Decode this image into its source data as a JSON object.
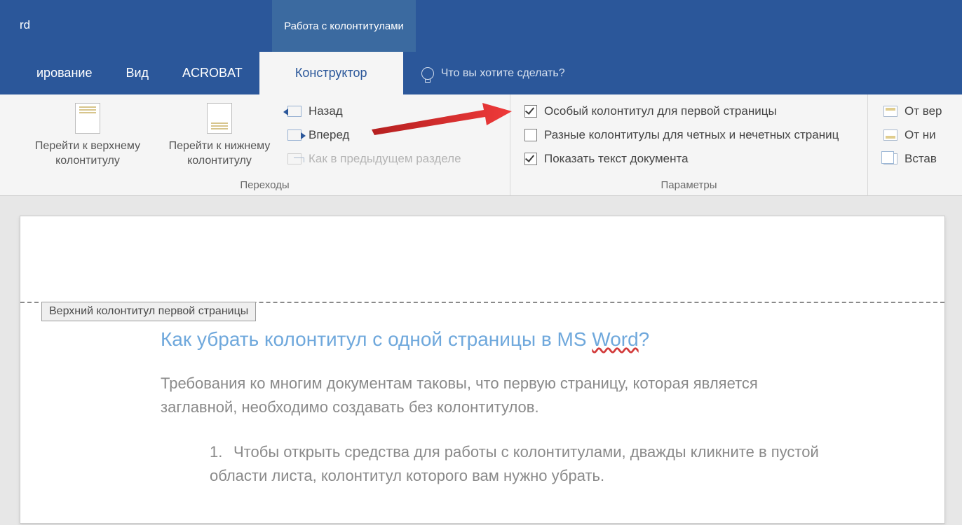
{
  "titlebar": {
    "app_fragment": "rd",
    "contextual_tab": "Работа с колонтитулами"
  },
  "tabs": {
    "editing": "ирование",
    "view": "Вид",
    "acrobat": "ACROBAT",
    "designer": "Конструктор",
    "tellme_placeholder": "Что вы хотите сделать?"
  },
  "ribbon": {
    "nav": {
      "goto_header_l1": "Перейти к верхнему",
      "goto_header_l2": "колонтитулу",
      "goto_footer_l1": "Перейти к нижнему",
      "goto_footer_l2": "колонтитулу",
      "back": "Назад",
      "forward": "Вперед",
      "link_prev": "Как в предыдущем разделе",
      "group_label": "Переходы"
    },
    "options": {
      "diff_first": "Особый колонтитул для первой страницы",
      "diff_odd_even": "Разные колонтитулы для четных и нечетных страниц",
      "show_doc_text": "Показать текст документа",
      "group_label": "Параметры",
      "checked_first": true,
      "checked_odd_even": false,
      "checked_show_text": true
    },
    "position": {
      "from_top_frag": "От вер",
      "from_bottom_frag": "От ни",
      "insert_frag": "Встав"
    }
  },
  "header_tag": "Верхний колонтитул первой страницы",
  "document": {
    "title_prefix": "Как убрать колонтитул с одной страницы в MS ",
    "title_err": "Word",
    "title_suffix": "?",
    "para1": "Требования ко многим документам таковы, что первую страницу, которая является заглавной, необходимо создавать без колонтитулов.",
    "list1_num": "1.",
    "list1_text": "Чтобы открыть средства для работы с колонтитулами, дважды кликните в пустой области листа, колонтитул которого вам нужно убрать."
  }
}
